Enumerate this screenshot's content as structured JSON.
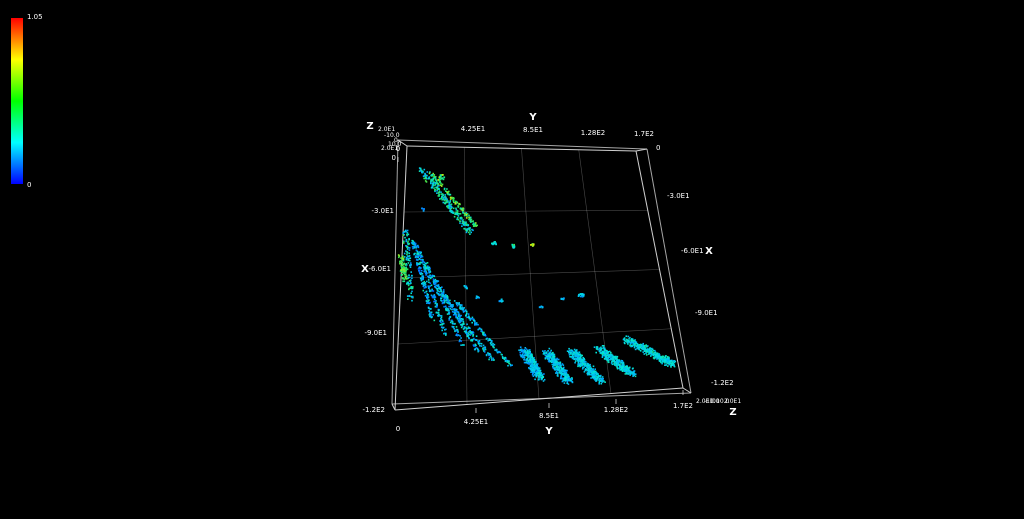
{
  "colorbar": {
    "max_label": "1.05",
    "min_label": "0",
    "colors": [
      "#ff0000",
      "#ffff00",
      "#00ff00",
      "#00ffff",
      "#0000ff"
    ]
  },
  "chart_data": {
    "type": "scatter",
    "subtype": "3d-point-cloud",
    "axes": {
      "x": {
        "label": "X",
        "ticks": [
          "0",
          "-3.0E1",
          "-6.0E1",
          "-9.0E1",
          "-1.2E2"
        ]
      },
      "y": {
        "label": "Y",
        "ticks": [
          "0",
          "4.25E1",
          "8.5E1",
          "1.28E2",
          "1.7E2"
        ]
      },
      "z": {
        "label": "Z",
        "ticks": [
          "2.0E1",
          "-10.0",
          "0",
          "10.0",
          "2.0E1"
        ]
      }
    },
    "legend": {
      "type": "colorbar",
      "placement": "top-left",
      "range": [
        0,
        1.05
      ]
    },
    "grid": true,
    "background": "#000000",
    "axis_color": "#d0d0d0"
  }
}
